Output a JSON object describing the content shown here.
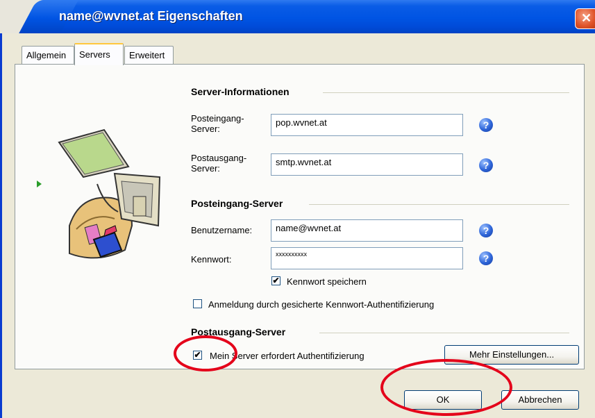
{
  "window": {
    "title": "name@wvnet.at Eigenschaften"
  },
  "tabs": [
    {
      "label": "Allgemein",
      "active": false
    },
    {
      "label": "Servers",
      "active": true
    },
    {
      "label": "Erweitert",
      "active": false
    }
  ],
  "server_info": {
    "heading": "Server-Informationen",
    "incoming_label_1": "Posteingang-",
    "incoming_label_2": "Server:",
    "incoming_value": "pop.wvnet.at",
    "outgoing_label_1": "Postausgang-",
    "outgoing_label_2": "Server:",
    "outgoing_value": "smtp.wvnet.at"
  },
  "incoming_server": {
    "heading": "Posteingang-Server",
    "username_label": "Benutzername:",
    "username_value": "name@wvnet.at",
    "password_label": "Kennwort:",
    "password_value": "xxxxxxxxxx",
    "save_password_label": "Kennwort speichern",
    "save_password_checked": true,
    "spa_label": "Anmeldung durch gesicherte Kennwort-Authentifizierung",
    "spa_checked": false
  },
  "outgoing_server": {
    "heading": "Postausgang-Server",
    "auth_label": "Mein Server erfordert Authentifizierung",
    "auth_checked": true,
    "more_settings_label": "Mehr Einstellungen..."
  },
  "buttons": {
    "ok": "OK",
    "cancel": "Abbrechen"
  },
  "icons": {
    "help": "help-question-icon",
    "check": "✔"
  },
  "colors": {
    "titlebar": "#0054e3",
    "highlight": "#e4001a",
    "tab_active_top": "#ffc73c"
  }
}
